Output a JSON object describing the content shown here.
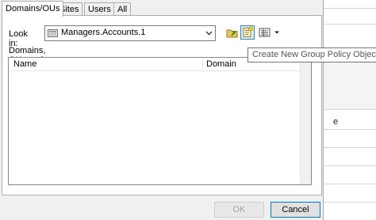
{
  "tabs": [
    {
      "label": "Domains/OUs",
      "active": true
    },
    {
      "label": "Sites",
      "active": false
    },
    {
      "label": "Users",
      "active": false
    },
    {
      "label": "All",
      "active": false
    }
  ],
  "look_in": {
    "label": "Look in:",
    "value": "Managers.Accounts.1",
    "icon": "folder-ou-icon"
  },
  "toolbar": {
    "up_icon": "up-folder-icon",
    "new_gpo_icon": "new-gpo-icon",
    "view_icon": "view-menu-icon"
  },
  "section_label": "Domains, OUs and linked Group Policy Objects:",
  "list": {
    "columns": [
      "Name",
      "Domain"
    ],
    "rows": []
  },
  "tooltip": "Create New Group Policy Object",
  "buttons": {
    "ok": "OK",
    "cancel": "Cancel"
  },
  "background_window": {
    "fragment": "e"
  },
  "colors": {
    "accent": "#0078d7",
    "hover_fill": "#d6ebfb"
  }
}
